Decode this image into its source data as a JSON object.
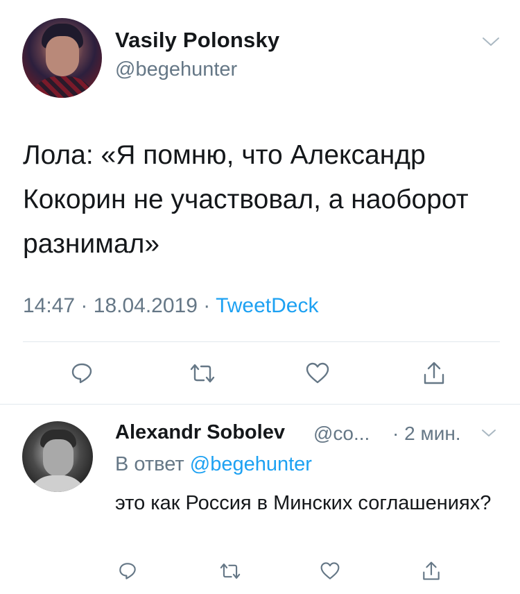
{
  "tweet": {
    "author_name": "Vasily Polonsky",
    "author_handle": "@begehunter",
    "text": "Лола: «Я помню, что Александр Кокорин не участвовал, а наоборот разнимал»",
    "time": "14:47",
    "separator": "·",
    "date": "18.04.2019",
    "source": "TweetDeck",
    "menu_icon": "chevron-down-icon",
    "actions": [
      "reply-icon",
      "retweet-icon",
      "like-icon",
      "share-icon"
    ]
  },
  "reply": {
    "author_name": "Alexandr Sobolev",
    "author_handle": "@co...",
    "time": "· 2 мин.",
    "reply_to_prefix": "В ответ",
    "reply_to_handle": "@begehunter",
    "text": "это как Россия в Минских соглашениях?",
    "menu_icon": "chevron-down-icon",
    "actions": [
      "reply-icon",
      "retweet-icon",
      "like-icon",
      "share-icon"
    ]
  },
  "colors": {
    "text": "#14171a",
    "secondary": "#657786",
    "link": "#1da1f2",
    "divider": "#e1e8ed",
    "icon": "#657786"
  }
}
